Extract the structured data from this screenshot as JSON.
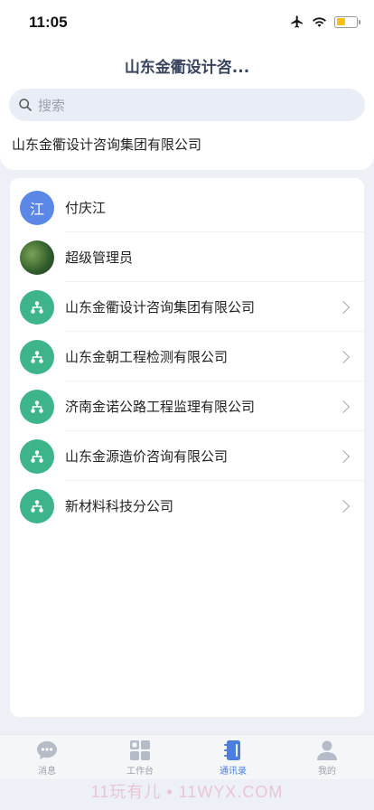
{
  "status_bar": {
    "time": "11:05"
  },
  "header": {
    "title": "山东金衢设计咨...",
    "search_placeholder": "搜索",
    "breadcrumb": "山东金衢设计咨询集团有限公司"
  },
  "contacts": [
    {
      "label": "付庆江",
      "avatar_text": "江",
      "type": "person"
    },
    {
      "label": "超级管理员",
      "type": "photo"
    },
    {
      "label": "山东金衢设计咨询集团有限公司",
      "type": "org"
    },
    {
      "label": "山东金朝工程检测有限公司",
      "type": "org"
    },
    {
      "label": "济南金诺公路工程监理有限公司",
      "type": "org"
    },
    {
      "label": "山东金源造价咨询有限公司",
      "type": "org"
    },
    {
      "label": "新材料科技分公司",
      "type": "org"
    }
  ],
  "tabbar": {
    "items": [
      {
        "label": "消息",
        "icon": "chat-bubble-icon"
      },
      {
        "label": "工作台",
        "icon": "grid-icon"
      },
      {
        "label": "通讯录",
        "icon": "contacts-book-icon",
        "active": true
      },
      {
        "label": "我的",
        "icon": "user-icon"
      }
    ]
  },
  "watermark": "11玩有儿 • 11WYX.COM",
  "colors": {
    "accent": "#4a7fe0",
    "org": "#3db489",
    "person": "#5b87e6"
  }
}
